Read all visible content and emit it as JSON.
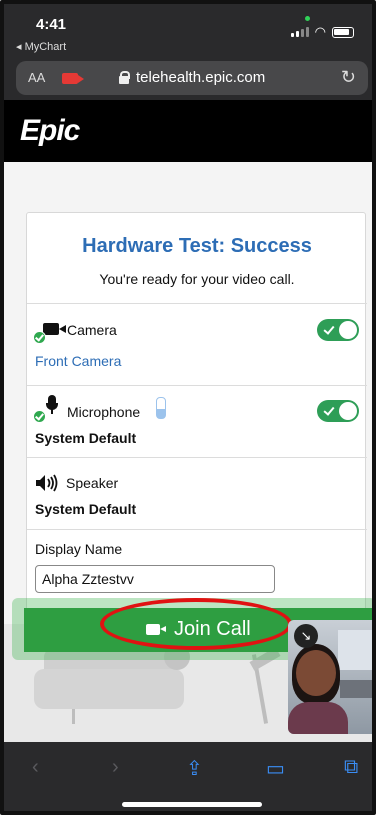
{
  "status_bar": {
    "time": "4:41",
    "back_app": "◂ MyChart"
  },
  "browser": {
    "text_size_label": "AA",
    "url": "telehealth.epic.com",
    "reload_glyph": "↻"
  },
  "brand": {
    "logo_text": "Epic"
  },
  "hardware_test": {
    "title": "Hardware Test: Success",
    "subtitle": "You're ready for your video call.",
    "camera": {
      "label": "Camera",
      "device": "Front Camera",
      "enabled": true
    },
    "microphone": {
      "label": "Microphone",
      "device": "System Default",
      "enabled": true
    },
    "speaker": {
      "label": "Speaker",
      "device": "System Default"
    },
    "display_name": {
      "label": "Display Name",
      "value": "Alpha Zztestvv"
    }
  },
  "actions": {
    "join_call_label": "Join Call"
  },
  "toolbar": {
    "back": "‹",
    "forward": "›",
    "share": "⇪",
    "bookmarks": "▭",
    "tabs": "⧉"
  },
  "colors": {
    "accent_blue": "#2d6db5",
    "join_green": "#2e9e41",
    "highlight_red": "#e01212"
  }
}
